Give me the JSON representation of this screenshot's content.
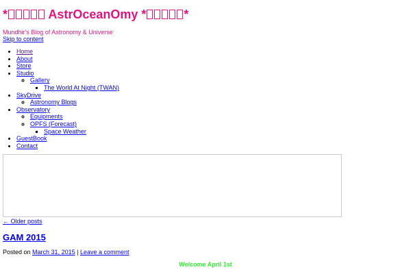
{
  "site": {
    "title_prefix": "*",
    "title_text": " AstrOceanOmy ",
    "title_suffix": "*",
    "tagline": "Mundhir's Blog of Astronomy & Universe",
    "skip_link": "Skip to content"
  },
  "nav": {
    "home": "Home",
    "about": "About",
    "store": "Store",
    "studio": "Studio",
    "gallery": "Gallery",
    "twan": "The World At Night (TWAN)",
    "skydrive": "SkyDrive",
    "astronomy_blogs": "Astronomy Blogs",
    "observatory": "Observatory",
    "equipments": "Equipments",
    "opfs": "OPFS (Forecast)",
    "space_weather": "Space Weather",
    "guestbook": "GuestBook",
    "contact": "Contact"
  },
  "pagination": {
    "older_posts": "← Older posts"
  },
  "post": {
    "title": "GAM 2015",
    "posted_on_label": "Posted on",
    "date": "March 31, 2015",
    "separator": "|",
    "comment_link": "Leave a comment",
    "heading": "Welcome April 1st"
  },
  "colors": {
    "title": "#e0147e",
    "link": "#0000ee",
    "visited_link": "#551a8b",
    "heading_green": "#33ee33"
  }
}
